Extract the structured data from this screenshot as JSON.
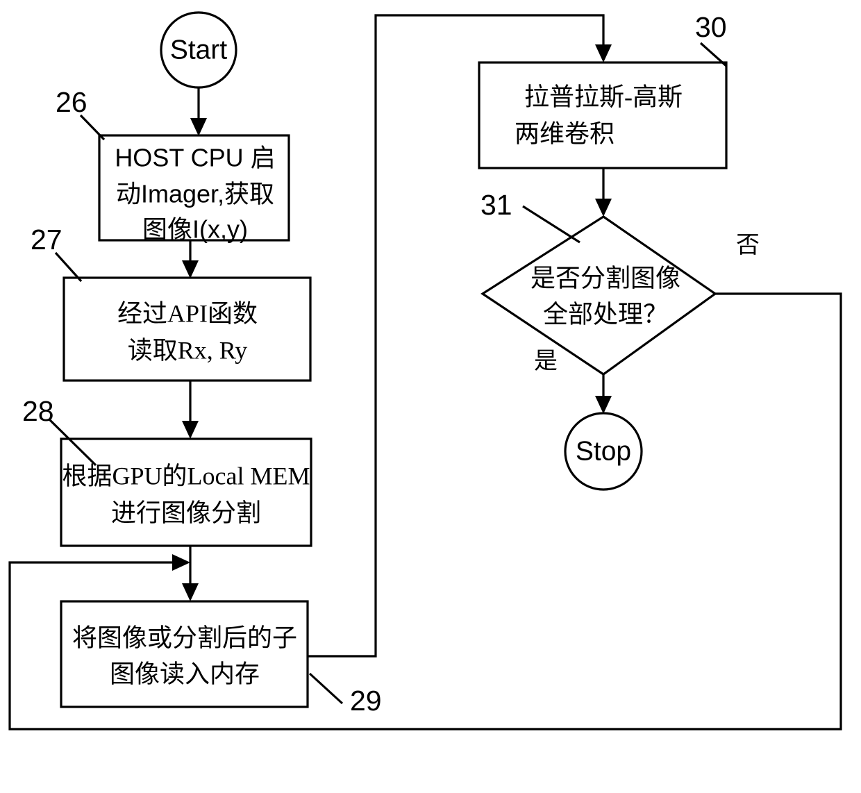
{
  "diagram": {
    "type": "flowchart",
    "title": "",
    "terminals": {
      "start": "Start",
      "stop": "Stop"
    },
    "nodes": [
      {
        "id": "n26",
        "ref": "26",
        "shape": "process",
        "lines": [
          "HOST CPU  启",
          "动Imager,获取",
          "图像I(x,y)"
        ]
      },
      {
        "id": "n27",
        "ref": "27",
        "shape": "process",
        "lines": [
          "经过API函数",
          "读取Rx, Ry"
        ]
      },
      {
        "id": "n28",
        "ref": "28",
        "shape": "process",
        "lines": [
          "根据GPU的Local  MEM",
          "进行图像分割"
        ]
      },
      {
        "id": "n29",
        "ref": "29",
        "shape": "process",
        "lines": [
          "将图像或分割后的子",
          "图像读入内存"
        ]
      },
      {
        "id": "n30",
        "ref": "30",
        "shape": "process",
        "lines": [
          "拉普拉斯-高斯",
          "两维卷积"
        ]
      },
      {
        "id": "n31",
        "ref": "31",
        "shape": "decision",
        "lines": [
          "是否分割图像",
          "全部处理？"
        ]
      }
    ],
    "branch_labels": {
      "yes": "是",
      "no": "否"
    },
    "ref_numbers": [
      "26",
      "27",
      "28",
      "29",
      "30",
      "31"
    ],
    "colors": {
      "stroke": "#000000",
      "fill": "#ffffff",
      "text": "#000000"
    }
  }
}
